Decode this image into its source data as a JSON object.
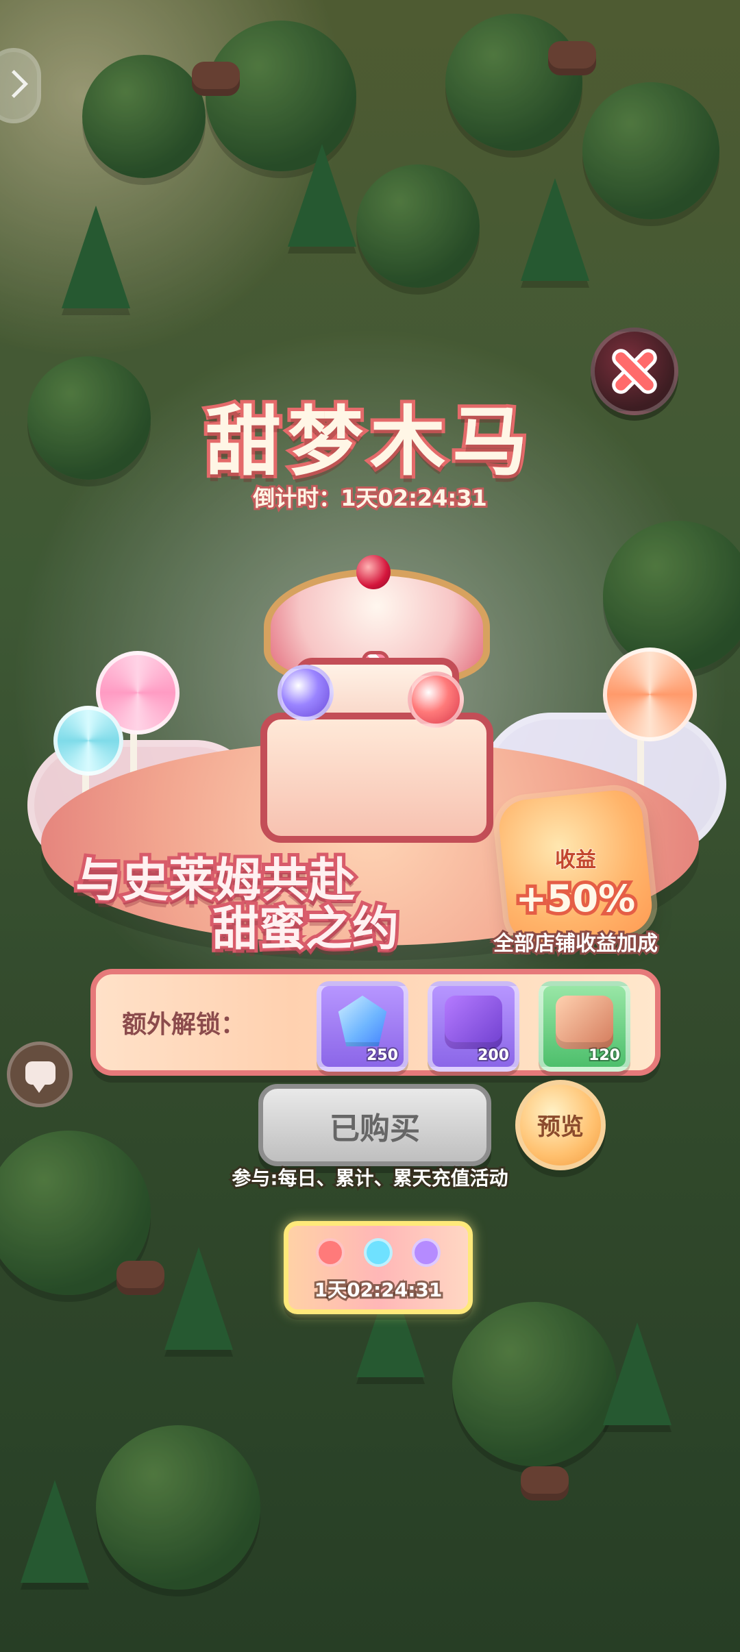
{
  "event": {
    "title": "甜梦木马",
    "countdown_label": "倒计时：1天02:24:31",
    "slogan_line1": "与史莱姆共赴",
    "slogan_line2": "甜蜜之约",
    "bonus": {
      "title": "收益",
      "value": "+50%",
      "description": "全部店铺收益加成"
    },
    "extra_unlock": {
      "label": "额外解锁：",
      "rewards": [
        {
          "icon": "crystal-icon",
          "count": "250"
        },
        {
          "icon": "book-icon",
          "count": "200"
        },
        {
          "icon": "card-coins-icon",
          "count": "120"
        }
      ]
    },
    "buy_button_label": "已购买",
    "preview_button_label": "预览",
    "participate_text": "参与:每日、累计、累天充值活动",
    "thumbnail_timer": "1天02:24:31"
  }
}
